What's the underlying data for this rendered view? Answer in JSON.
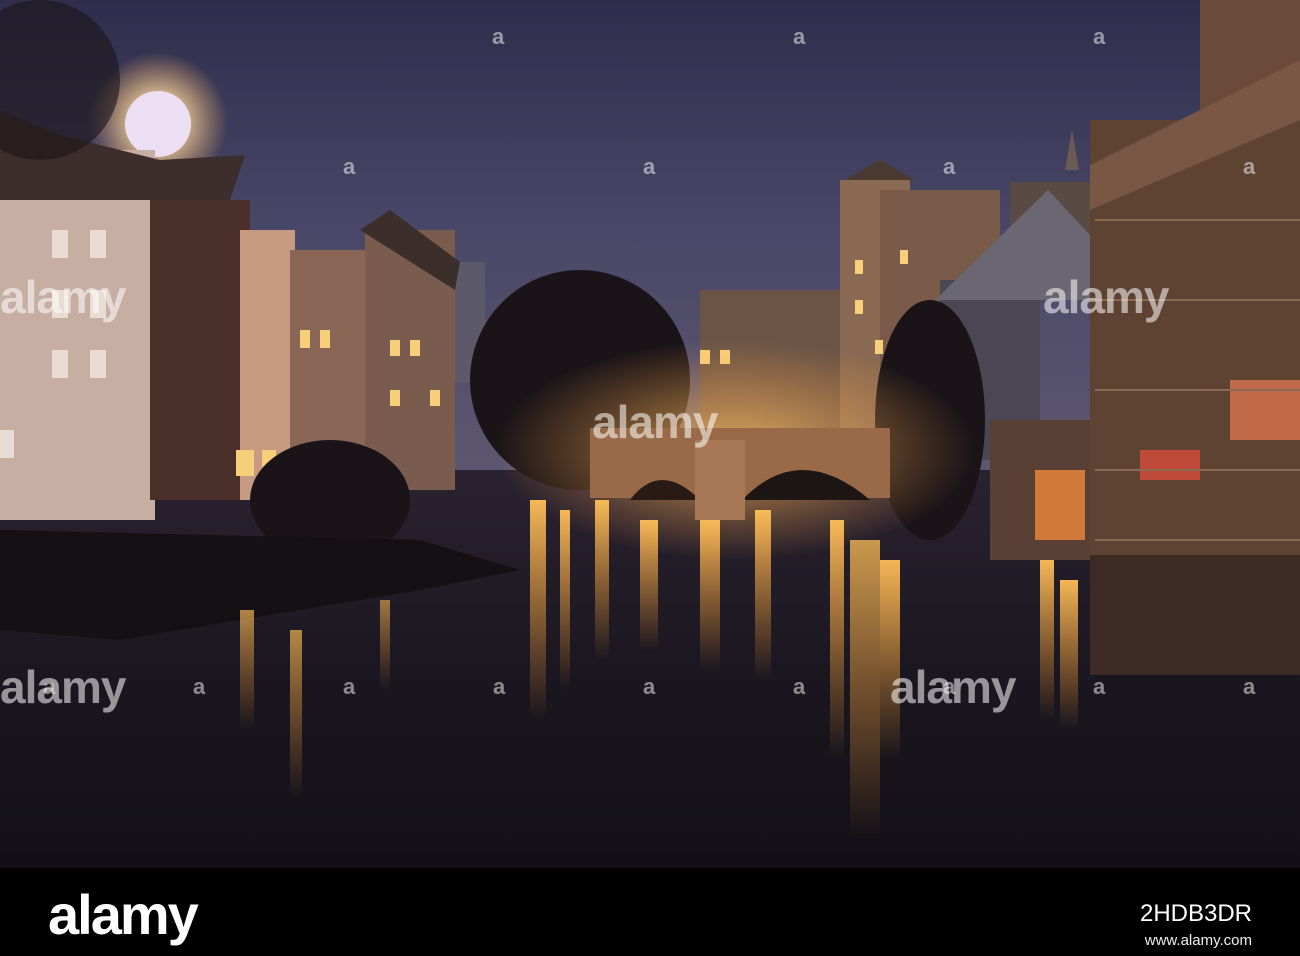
{
  "watermark": {
    "brand": "alamy",
    "marks_small": [
      "a",
      "a",
      "a",
      "a",
      "a",
      "a",
      "a",
      "a",
      "a",
      "a",
      "a",
      "a",
      "a",
      "a",
      "a",
      "a"
    ]
  },
  "footer": {
    "logo": "alamy",
    "image_id": "2HDB3DR",
    "url": "www.alamy.com"
  },
  "colors": {
    "sky": "#3b3a5e",
    "water": "#1a1620",
    "light": "#f7b04a",
    "moon": "#ecdff3"
  }
}
